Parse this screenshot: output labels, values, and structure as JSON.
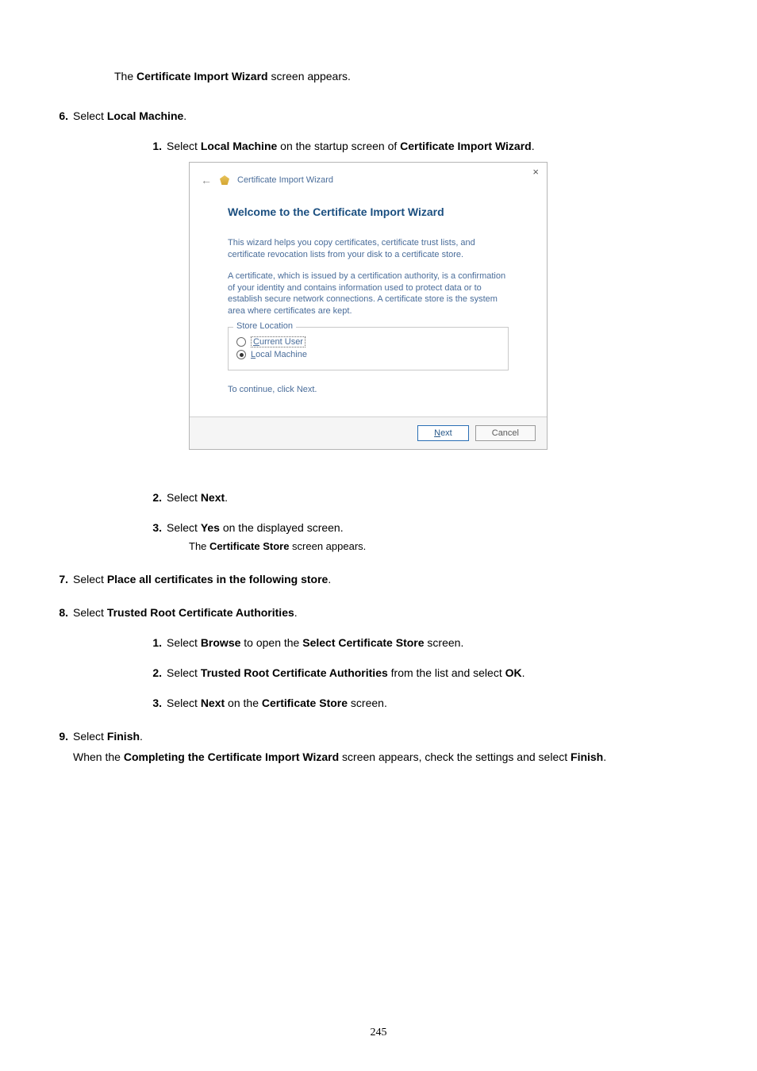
{
  "intro_pre": "The ",
  "intro_bold": "Certificate Import Wizard",
  "intro_post": " screen appears.",
  "step6": {
    "num": "6.",
    "pre": "Select ",
    "bold": "Local Machine",
    "post": ".",
    "sub1": {
      "num": "1.",
      "pre": "Select ",
      "b1": "Local Machine",
      "mid": " on the startup screen of ",
      "b2": "Certificate Import Wizard",
      "post": "."
    },
    "sub2": {
      "num": "2.",
      "pre": "Select ",
      "b": "Next",
      "post": "."
    },
    "sub3": {
      "num": "3.",
      "pre": "Select ",
      "b": "Yes",
      "post": " on the displayed screen.",
      "note_pre": "The ",
      "note_b": "Certificate Store",
      "note_post": " screen appears."
    }
  },
  "wizard": {
    "title": "Certificate Import Wizard",
    "heading": "Welcome to the Certificate Import Wizard",
    "p1": "This wizard helps you copy certificates, certificate trust lists, and certificate revocation lists from your disk to a certificate store.",
    "p2": "A certificate, which is issued by a certification authority, is a confirmation of your identity and contains information used to protect data or to establish secure network connections. A certificate store is the system area where certificates are kept.",
    "store_location": "Store Location",
    "current_user_u": "C",
    "current_user_rest": "urrent User",
    "local_machine_u": "L",
    "local_machine_rest": "ocal Machine",
    "continue_text": "To continue, click Next.",
    "next_u": "N",
    "next_rest": "ext",
    "cancel": "Cancel",
    "close": "×"
  },
  "step7": {
    "num": "7.",
    "pre": "Select ",
    "bold": "Place all certificates in the following store",
    "post": "."
  },
  "step8": {
    "num": "8.",
    "pre": "Select ",
    "bold": "Trusted Root Certificate Authorities",
    "post": ".",
    "sub1": {
      "num": "1.",
      "pre": "Select ",
      "b1": "Browse",
      "mid": " to open the ",
      "b2": "Select Certificate Store",
      "post": " screen."
    },
    "sub2": {
      "num": "2.",
      "pre": "Select ",
      "b1": "Trusted Root Certificate Authorities",
      "mid": " from the list and select ",
      "b2": "OK",
      "post": "."
    },
    "sub3": {
      "num": "3.",
      "pre": "Select ",
      "b1": "Next",
      "mid": " on the ",
      "b2": "Certificate Store",
      "post": " screen."
    }
  },
  "step9": {
    "num": "9.",
    "pre": "Select ",
    "bold": "Finish",
    "post": ".",
    "body_pre": "When the ",
    "body_b1": "Completing the Certificate Import Wizard",
    "body_mid": " screen appears, check the settings and select ",
    "body_b2": "Finish",
    "body_post": "."
  },
  "page_number": "245"
}
